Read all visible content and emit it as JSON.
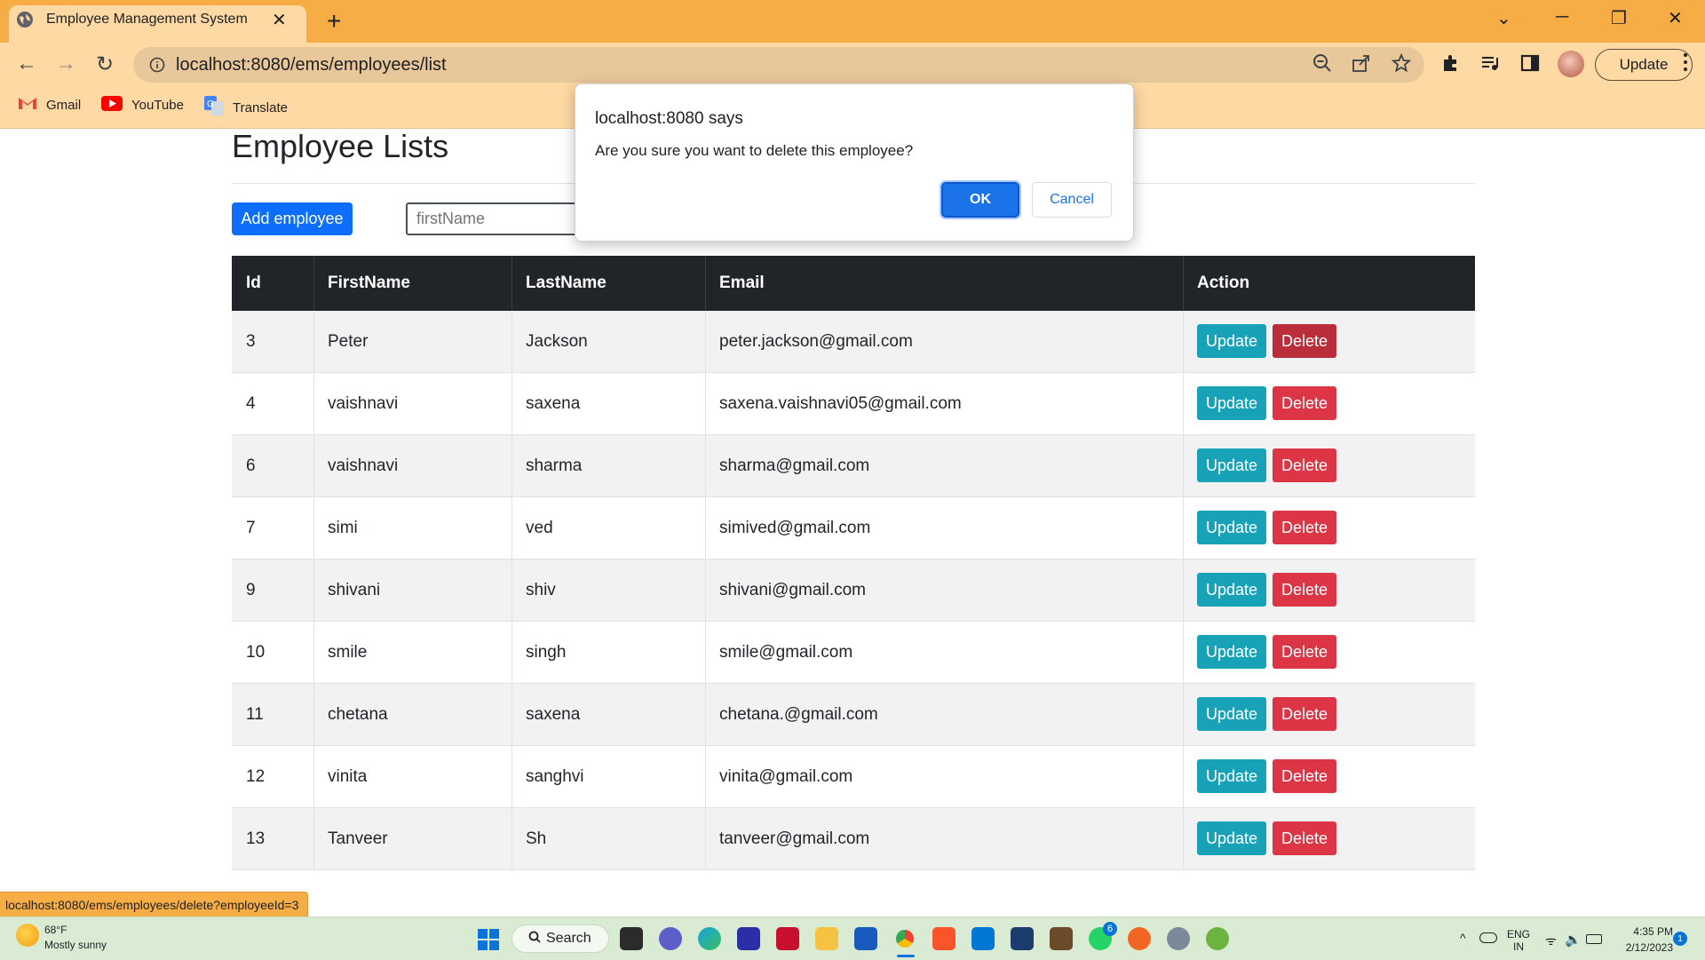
{
  "browser": {
    "tab_title": "Employee Management System",
    "new_tab": "+",
    "url": "localhost:8080/ems/employees/list",
    "update_label": "Update",
    "bookmarks": [
      {
        "label": "Gmail",
        "icon": "gmail-icon"
      },
      {
        "label": "YouTube",
        "icon": "youtube-icon"
      },
      {
        "label": "Translate",
        "icon": "translate-icon"
      }
    ],
    "status_url": "localhost:8080/ems/employees/delete?employeeId=3"
  },
  "page": {
    "title": "Employee Lists",
    "add_button": "Add employee",
    "search_placeholder": "firstName"
  },
  "table": {
    "headers": [
      "Id",
      "FirstName",
      "LastName",
      "Email",
      "Action"
    ],
    "update_label": "Update",
    "delete_label": "Delete",
    "rows": [
      {
        "id": "3",
        "first": "Peter",
        "last": "Jackson",
        "email": "peter.jackson@gmail.com"
      },
      {
        "id": "4",
        "first": "vaishnavi",
        "last": "saxena",
        "email": "saxena.vaishnavi05@gmail.com"
      },
      {
        "id": "6",
        "first": "vaishnavi",
        "last": "sharma",
        "email": "sharma@gmail.com"
      },
      {
        "id": "7",
        "first": "simi",
        "last": "ved",
        "email": "simived@gmail.com"
      },
      {
        "id": "9",
        "first": "shivani",
        "last": "shiv",
        "email": "shivani@gmail.com"
      },
      {
        "id": "10",
        "first": "smile",
        "last": "singh",
        "email": "smile@gmail.com"
      },
      {
        "id": "11",
        "first": "chetana",
        "last": "saxena",
        "email": "chetana.@gmail.com"
      },
      {
        "id": "12",
        "first": "vinita",
        "last": "sanghvi",
        "email": "vinita@gmail.com"
      },
      {
        "id": "13",
        "first": "Tanveer",
        "last": "Sh",
        "email": "tanveer@gmail.com"
      }
    ]
  },
  "dialog": {
    "title": "localhost:8080 says",
    "message": "Are you sure you want to delete this employee?",
    "ok": "OK",
    "cancel": "Cancel"
  },
  "taskbar": {
    "weather_temp": "68°F",
    "weather_desc": "Mostly sunny",
    "search_label": "Search",
    "lang": "ENG",
    "region": "IN",
    "time": "4:35 PM",
    "date": "2/12/2023",
    "notification_count": "1",
    "whatsapp_badge": "6"
  },
  "colors": {
    "tab_bar": "#f6ad45",
    "toolbar": "#ffd9a4",
    "primary": "#0d6efd",
    "info": "#17a2b8",
    "danger": "#dc3545",
    "table_header": "#212529",
    "taskbar": "#d9ecd3"
  }
}
